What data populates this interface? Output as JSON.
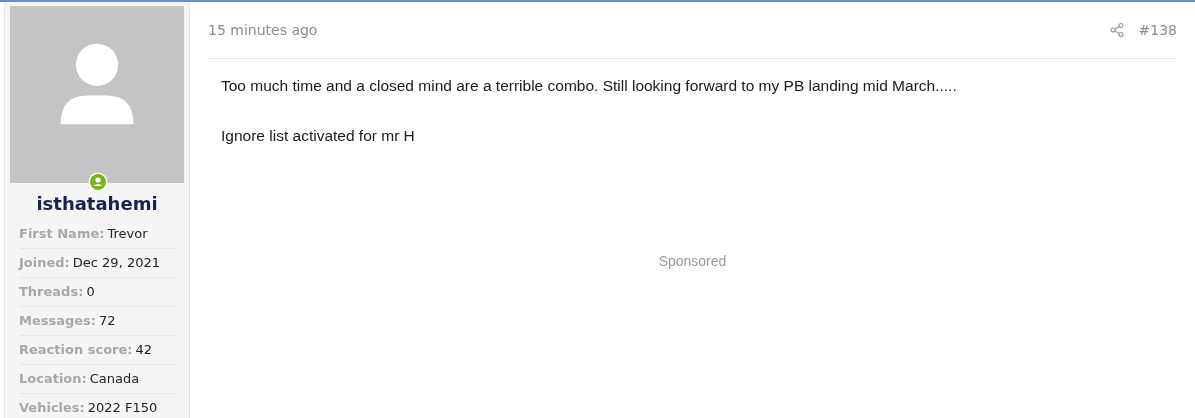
{
  "user": {
    "username": "isthatahemi",
    "online": true,
    "fields": [
      {
        "label": "First Name:",
        "value": "Trevor"
      },
      {
        "label": "Joined:",
        "value": "Dec 29, 2021"
      },
      {
        "label": "Threads:",
        "value": "0"
      },
      {
        "label": "Messages:",
        "value": "72"
      },
      {
        "label": "Reaction score:",
        "value": "42"
      },
      {
        "label": "Location:",
        "value": "Canada"
      },
      {
        "label": "Vehicles:",
        "value": "2022 F150"
      }
    ]
  },
  "post": {
    "time": "15 minutes ago",
    "number": "#138",
    "paragraphs": [
      "Too much time and a closed mind are a terrible combo. Still looking forward to my PB landing mid March.....",
      "Ignore list activated for mr H"
    ],
    "sponsored": "Sponsored"
  }
}
